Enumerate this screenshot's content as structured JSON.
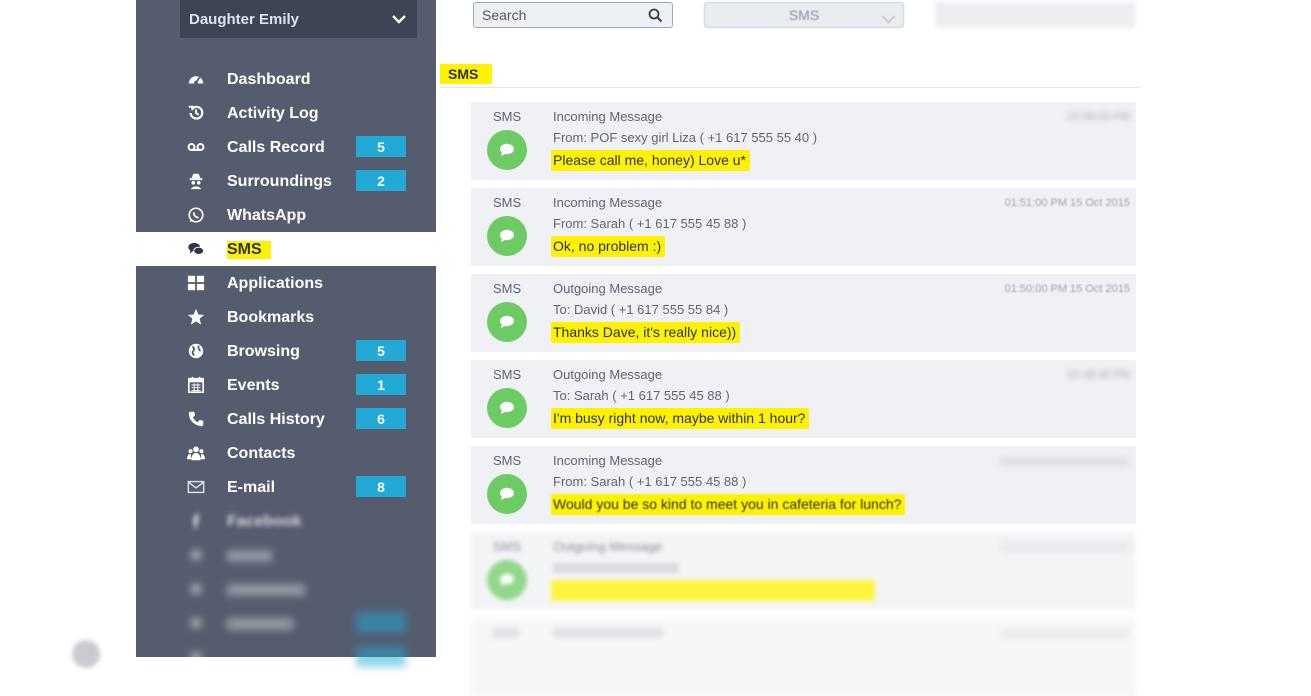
{
  "device": {
    "name": "Daughter Emily",
    "icon": "chevron-down-icon"
  },
  "nav": [
    {
      "id": "dashboard",
      "label": "Dashboard",
      "icon": "dashboard-icon",
      "badge": ""
    },
    {
      "id": "activity-log",
      "label": "Activity Log",
      "icon": "history-icon",
      "badge": ""
    },
    {
      "id": "calls-record",
      "label": "Calls Record",
      "icon": "voicemail-icon",
      "badge": "5"
    },
    {
      "id": "surroundings",
      "label": "Surroundings",
      "icon": "spy-icon",
      "badge": "2"
    },
    {
      "id": "whatsapp",
      "label": "WhatsApp",
      "icon": "whatsapp-icon",
      "badge": ""
    },
    {
      "id": "sms",
      "label": "SMS",
      "icon": "chat-icon",
      "badge": "",
      "active": true
    },
    {
      "id": "applications",
      "label": "Applications",
      "icon": "grid-icon",
      "badge": ""
    },
    {
      "id": "bookmarks",
      "label": "Bookmarks",
      "icon": "star-icon",
      "badge": ""
    },
    {
      "id": "browsing",
      "label": "Browsing",
      "icon": "globe-icon",
      "badge": "5"
    },
    {
      "id": "events",
      "label": "Events",
      "icon": "calendar-icon",
      "badge": "1"
    },
    {
      "id": "calls-history",
      "label": "Calls History",
      "icon": "phone-icon",
      "badge": "6"
    },
    {
      "id": "contacts",
      "label": "Contacts",
      "icon": "contacts-icon",
      "badge": ""
    },
    {
      "id": "email",
      "label": "E-mail",
      "icon": "envelope-icon",
      "badge": "8"
    },
    {
      "id": "facebook",
      "label": "Facebook",
      "icon": "facebook-icon",
      "badge": ""
    }
  ],
  "search": {
    "placeholder": "Search",
    "icon": "search-icon"
  },
  "type_filter": {
    "value": "SMS"
  },
  "section_title": "SMS",
  "messages": [
    {
      "kind": "SMS",
      "direction": "Incoming Message",
      "contact": "From: POF sexy girl Liza ( +1 617 555 55 40 )",
      "text": "Please call me, honey) Love u*",
      "time": "02:56:00 PM"
    },
    {
      "kind": "SMS",
      "direction": "Incoming Message",
      "contact": "From: Sarah ( +1 617 555 45 88 )",
      "text": "Ok, no problem :)",
      "time": "01:51:00 PM 15 Oct 2015"
    },
    {
      "kind": "SMS",
      "direction": "Outgoing Message",
      "contact": "To: David ( +1 617 555 55 84 )",
      "text": "Thanks Dave, it's really nice))",
      "time": "01:50:00 PM 15 Oct 2015"
    },
    {
      "kind": "SMS",
      "direction": "Outgoing Message",
      "contact": "To: Sarah ( +1 617 555 45 88 )",
      "text": "I'm busy right now, maybe within 1 hour?",
      "time": "01:49:40 PM"
    },
    {
      "kind": "SMS",
      "direction": "Incoming Message",
      "contact": "From: Sarah ( +1 617 555 45 88 )",
      "text": "Would you be so kind to meet you in cafeteria for lunch?",
      "time": ""
    },
    {
      "kind": "SMS",
      "direction": "Outgoing Message",
      "contact": "",
      "text": "",
      "time": ""
    }
  ],
  "colors": {
    "sidebar": "#555c6e",
    "highlight": "#fff200",
    "badge": "#22a9d6",
    "avatar": "#6dcb64"
  }
}
